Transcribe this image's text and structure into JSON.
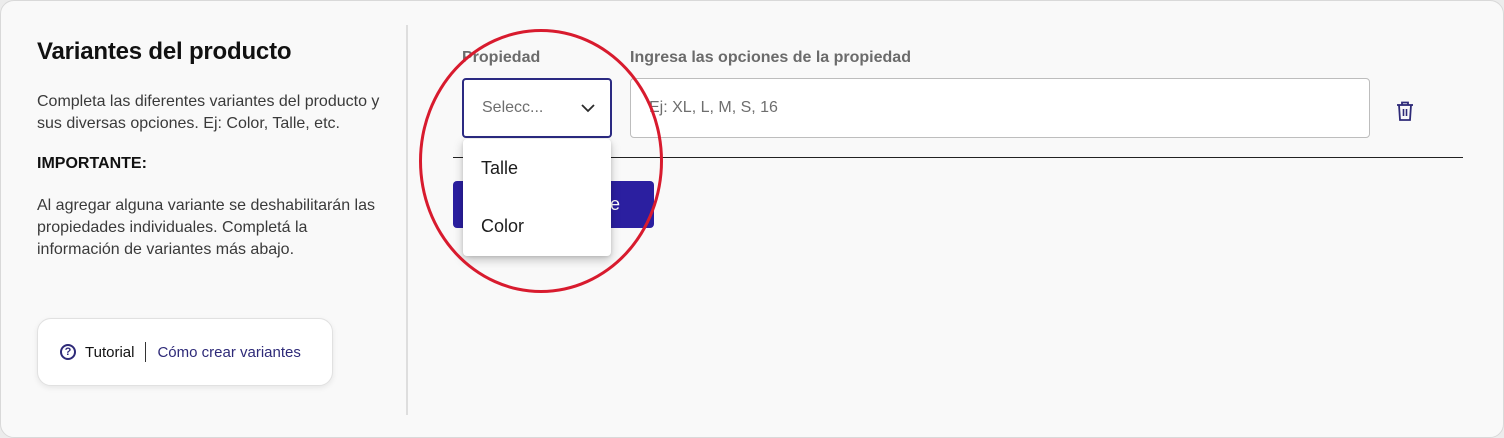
{
  "section": {
    "title": "Variantes del producto",
    "description": "Completa las diferentes variantes del producto y sus diversas opciones. Ej: Color, Talle, etc.",
    "important_label": "IMPORTANTE:",
    "note": "Al agregar alguna variante se deshabilitarán las propiedades individuales. Completá la información de variantes más abajo."
  },
  "tutorial": {
    "icon": "question-circle-icon",
    "icon_glyph": "?",
    "label": "Tutorial",
    "link": "Cómo crear variantes"
  },
  "form": {
    "property_label": "Propiedad",
    "property_select_value": "Selecc...",
    "options_label": "Ingresa las opciones de la propiedad",
    "options_placeholder": "Ej: XL, L, M, S, 16",
    "options_value": "",
    "delete_icon": "trash-icon",
    "add_button_label": "Agregar variante"
  },
  "dropdown": {
    "open": true,
    "options": [
      "Talle",
      "Color"
    ]
  },
  "colors": {
    "accent": "#2b1fa0",
    "link": "#2e2a78",
    "annotation": "#d81b2e"
  }
}
